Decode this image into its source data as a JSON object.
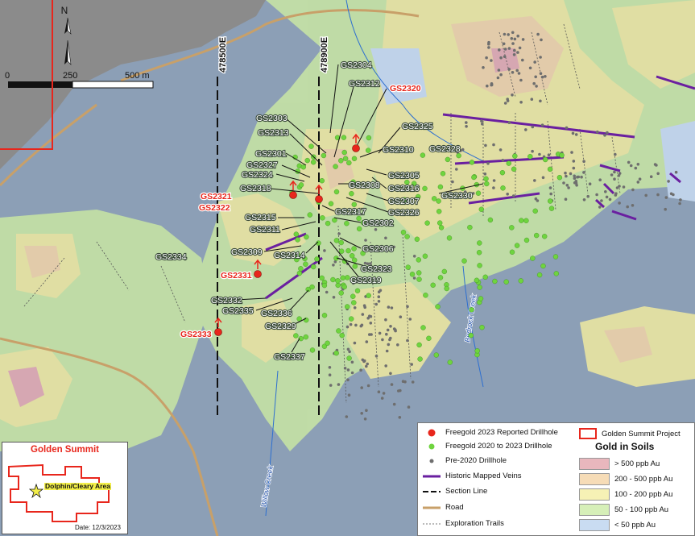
{
  "map": {
    "north_label": "N",
    "scale": {
      "ticks": [
        "0",
        "250",
        "500 m"
      ]
    },
    "section_lines": [
      "478500E",
      "478900E"
    ],
    "creeks": [
      "Willow Creek",
      "Bedrock Creek"
    ],
    "drillholes_2023": [
      "GS2320",
      "GS2321",
      "GS2322",
      "GS2331",
      "GS2333"
    ],
    "drillholes_2020_2023": [
      "GS2304",
      "GS2312",
      "GS2303",
      "GS2313",
      "GS2301",
      "GS2327",
      "GS2324",
      "GS2318",
      "GS2325",
      "GS2310",
      "GS2328",
      "GS2305",
      "GS2316",
      "GS2308",
      "GS2307",
      "GS2326",
      "GS2330",
      "GS2317",
      "GS2315",
      "GS2311",
      "GS2302",
      "GS2309",
      "GS2314",
      "GS2306",
      "GS2334",
      "GS2323",
      "GS2319",
      "GS2332",
      "GS2335",
      "GS2336",
      "GS2329",
      "GS2337"
    ]
  },
  "legend": {
    "reported_2023": "Freegold 2023 Reported Drillhole",
    "project": "Golden Summit Project",
    "drill_2020_2023": "Freegold 2020 to 2023 Drillhole",
    "gold_title": "Gold in Soils",
    "pre2020": "Pre-2020 Drillhole",
    "veins": "Historic Mapped Veins",
    "section": "Section Line",
    "road": "Road",
    "trails": "Exploration Trails",
    "soil_classes": [
      "> 500 ppb Au",
      "200 - 500 ppb Au",
      "100 - 200 ppb Au",
      "50 - 100 ppb Au",
      "< 50 ppb Au"
    ],
    "soil_colors": [
      "#e9b7bd",
      "#f6dcb7",
      "#f6f1b5",
      "#d6efb8",
      "#c9dcf2"
    ]
  },
  "inset": {
    "title": "Golden Summit",
    "area_label": "Dolphin/Cleary Area",
    "date": "Date: 12/3/2023"
  },
  "colors": {
    "reported": "#e8261c",
    "drill": "#6fd43f",
    "pre2020": "#6e6e6e",
    "veins": "#6a1fa0",
    "road": "#c8a069"
  }
}
